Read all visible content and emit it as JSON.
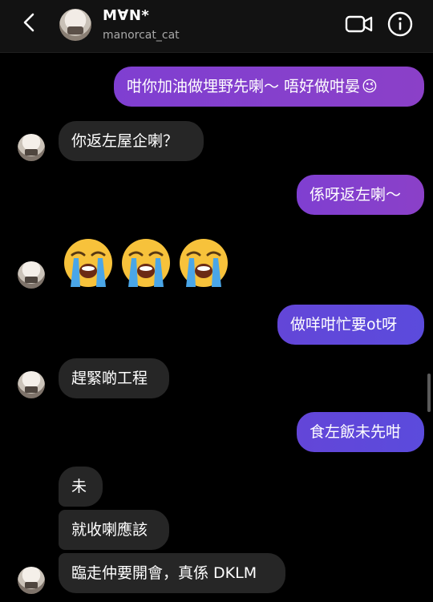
{
  "header": {
    "name": "M∀N*",
    "handle": "manorcat_cat",
    "back_icon": "chevron-left-icon",
    "video_icon": "video-camera-icon",
    "info_icon": "info-circle-icon"
  },
  "messages": {
    "m1": "咁你加油做埋野先喇～ 唔好做咁晏",
    "m1_emoji": "😉",
    "m2": "你返左屋企喇？",
    "m3": "係呀返左喇～",
    "m4_emojis": [
      "😭",
      "😭",
      "😭"
    ],
    "m5": "做咩咁忙要ot呀",
    "m6": "趕緊啲工程",
    "m7": "食左飯未先咁",
    "m8": "未",
    "m9": "就收喇應該",
    "m10": "臨走仲要開會，真係 DKLM"
  },
  "colors": {
    "outgoing_purple": "#8b40c8",
    "outgoing_blue": "#5b4bdc",
    "incoming": "#262626",
    "background": "#000000"
  }
}
